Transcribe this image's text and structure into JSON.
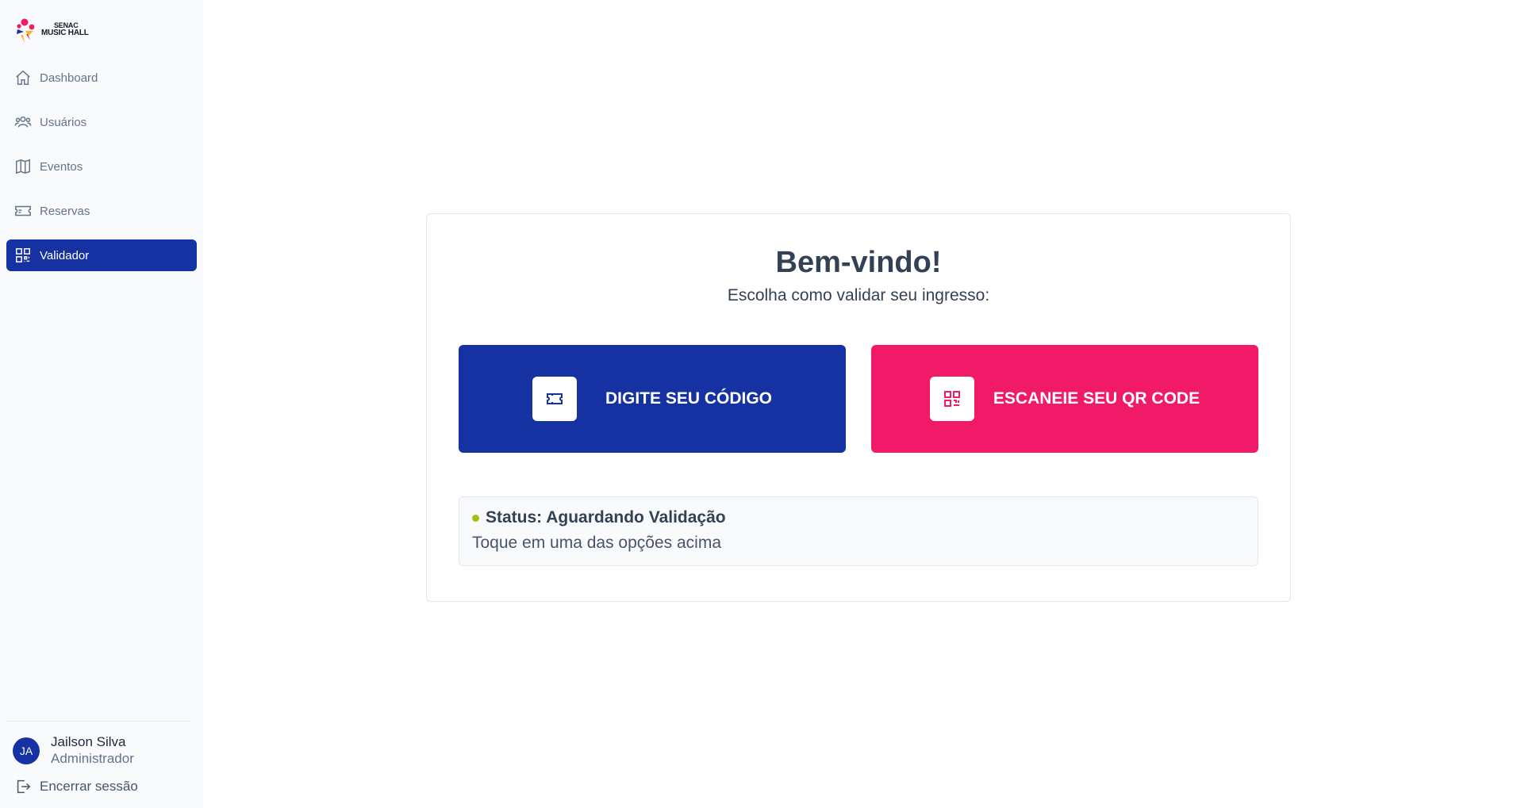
{
  "brand": {
    "line1": "SENAC",
    "line2": "MUSIC HALL"
  },
  "sidebar": {
    "items": [
      {
        "label": "Dashboard",
        "icon": "home-icon"
      },
      {
        "label": "Usuários",
        "icon": "users-icon"
      },
      {
        "label": "Eventos",
        "icon": "map-icon"
      },
      {
        "label": "Reservas",
        "icon": "ticket-icon"
      },
      {
        "label": "Validador",
        "icon": "qr-code-icon",
        "active": true
      }
    ]
  },
  "user": {
    "initials": "JA",
    "name": "Jailson Silva",
    "role": "Administrador"
  },
  "logout_label": "Encerrar sessão",
  "main": {
    "title": "Bem-vindo!",
    "subtitle": "Escolha como validar seu ingresso:",
    "option_code_label": "DIGITE SEU CÓDIGO",
    "option_qr_label": "ESCANEIE SEU QR CODE",
    "status_title": "Status: Aguardando Validação",
    "status_hint": "Toque em uma das opções acima"
  },
  "colors": {
    "primary": "#1631a1",
    "accent": "#f01a68",
    "status_dot": "#a3c011",
    "sidebar_bg": "#f8fafc"
  }
}
